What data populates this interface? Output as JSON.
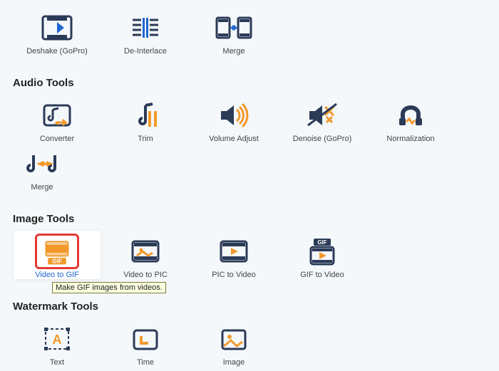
{
  "colors": {
    "navy": "#2b3a57",
    "orange": "#f3992b",
    "blue_accent": "#1e66d0",
    "red_select": "#e53935"
  },
  "top_row": [
    {
      "label": "Deshake (GoPro)",
      "icon": "deshake-icon"
    },
    {
      "label": "De-Interlace",
      "icon": "deinterlace-icon"
    },
    {
      "label": "Merge",
      "icon": "video-merge-icon"
    }
  ],
  "audio": {
    "title": "Audio Tools",
    "items": [
      {
        "label": "Converter",
        "icon": "audio-converter-icon"
      },
      {
        "label": "Trim",
        "icon": "audio-trim-icon"
      },
      {
        "label": "Volume Adjust",
        "icon": "volume-adjust-icon"
      },
      {
        "label": "Denoise (GoPro)",
        "icon": "denoise-icon"
      },
      {
        "label": "Normalization",
        "icon": "normalization-icon"
      },
      {
        "label": "Merge",
        "icon": "audio-merge-icon"
      }
    ]
  },
  "image": {
    "title": "Image Tools",
    "items": [
      {
        "label": "Video to GIF",
        "icon": "video-to-gif-icon",
        "selected": true,
        "tooltip": "Make GIF images from videos."
      },
      {
        "label": "Video to PIC",
        "icon": "video-to-pic-icon"
      },
      {
        "label": "PIC to Video",
        "icon": "pic-to-video-icon"
      },
      {
        "label": "GIF to Video",
        "icon": "gif-to-video-icon"
      }
    ]
  },
  "watermark": {
    "title": "Watermark Tools",
    "items": [
      {
        "label": "Text",
        "icon": "text-watermark-icon"
      },
      {
        "label": "Time",
        "icon": "time-watermark-icon"
      },
      {
        "label": "Image",
        "icon": "image-watermark-icon"
      }
    ]
  }
}
